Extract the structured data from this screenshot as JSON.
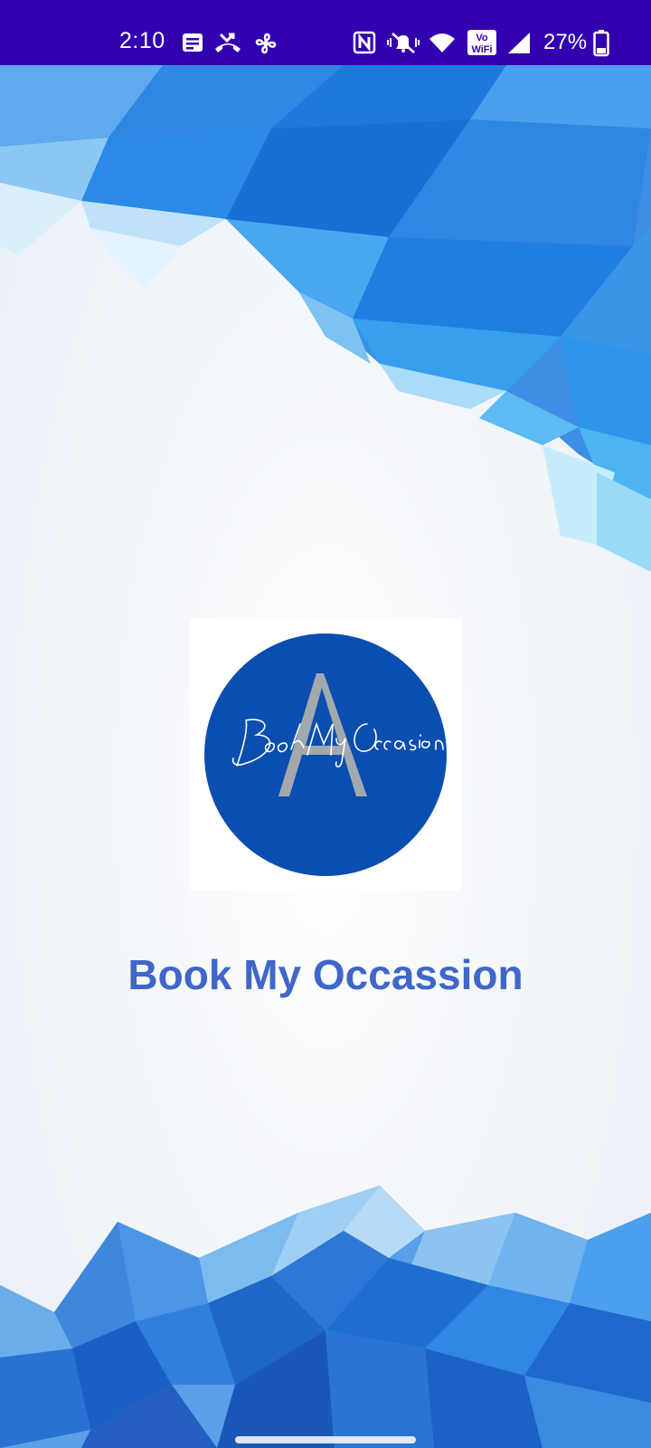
{
  "status_bar": {
    "time": "2:10",
    "battery_percent": "27%",
    "background_color": "#3300b0",
    "icons": [
      "notes-icon",
      "missed-call-icon",
      "fan-icon",
      "nfc-icon",
      "vibrate-off-icon",
      "wifi-icon",
      "vowifi-icon",
      "signal-icon",
      "battery-icon"
    ],
    "vowifi_label_top": "Vo",
    "vowifi_label_bottom": "WiFi"
  },
  "splash": {
    "app_name": "Book My Occassion",
    "app_name_color": "#3f66c9",
    "logo": {
      "script_text": "Book My Occasion",
      "monogram": "A",
      "circle_color": "#0a4fb0"
    }
  },
  "navigation": {
    "gesture_handle": "gesture-handle"
  }
}
